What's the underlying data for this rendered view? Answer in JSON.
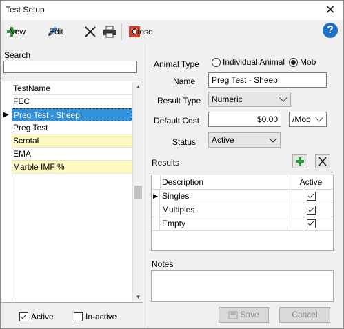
{
  "window": {
    "title": "Test Setup",
    "close_glyph": "✕"
  },
  "toolbar": {
    "new_label": "New",
    "edit_label": "Edit",
    "close_label": "Close",
    "icons": [
      "plus-icon",
      "pencil-icon",
      "delete-x-icon",
      "printer-icon",
      "close-red-icon",
      "help-icon"
    ],
    "help_glyph": "?"
  },
  "left": {
    "search_label": "Search",
    "search_value": "",
    "list": [
      {
        "text": "TestName",
        "style": "header"
      },
      {
        "text": "FEC",
        "style": "plain"
      },
      {
        "text": "Preg Test - Sheep",
        "style": "selected",
        "marker": "▶"
      },
      {
        "text": "Preg Test",
        "style": "plain"
      },
      {
        "text": "Scrotal",
        "style": "yellow"
      },
      {
        "text": "EMA",
        "style": "plain"
      },
      {
        "text": "Marble IMF %",
        "style": "yellow"
      }
    ],
    "filters": [
      {
        "label": "Active",
        "checked": true
      },
      {
        "label": "In-active",
        "checked": false
      }
    ]
  },
  "form": {
    "animal_type_label": "Animal Type",
    "radio_individual": "Individual Animal",
    "radio_mob": "Mob",
    "selected_radio": "Mob",
    "name_label": "Name",
    "name_value": "Preg Test - Sheep",
    "result_type_label": "Result Type",
    "result_type_value": "Numeric",
    "default_cost_label": "Default Cost",
    "default_cost_value": "$0.00",
    "cost_unit_value": "/Mob",
    "status_label": "Status",
    "status_value": "Active",
    "results_label": "Results",
    "results_columns": [
      "Description",
      "Active"
    ],
    "results_rows": [
      {
        "marker": "▶",
        "description": "Singles",
        "active": true
      },
      {
        "marker": "",
        "description": "Multiples",
        "active": true
      },
      {
        "marker": "",
        "description": "Empty",
        "active": true
      }
    ],
    "notes_label": "Notes",
    "save_label": "Save",
    "cancel_label": "Cancel"
  }
}
